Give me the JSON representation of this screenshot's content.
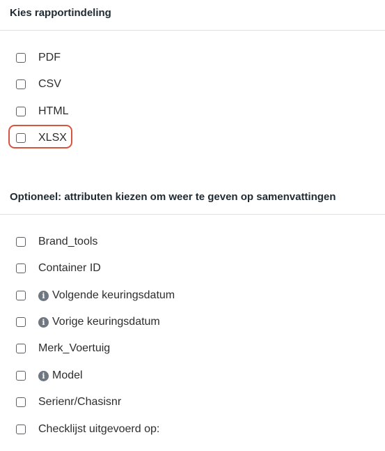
{
  "format_section": {
    "title": "Kies rapportindeling",
    "options": [
      {
        "label": "PDF",
        "checked": false
      },
      {
        "label": "CSV",
        "checked": false
      },
      {
        "label": "HTML",
        "checked": false
      },
      {
        "label": "XLSX",
        "checked": false,
        "highlighted": true
      }
    ]
  },
  "attributes_section": {
    "title": "Optioneel: attributen kiezen om weer te geven op samenvattingen",
    "options": [
      {
        "label": "Brand_tools",
        "checked": false,
        "info_icon": false
      },
      {
        "label": "Container ID",
        "checked": false,
        "info_icon": false
      },
      {
        "label": "Volgende keuringsdatum",
        "checked": false,
        "info_icon": true
      },
      {
        "label": "Vorige keuringsdatum",
        "checked": false,
        "info_icon": true
      },
      {
        "label": "Merk_Voertuig",
        "checked": false,
        "info_icon": false
      },
      {
        "label": "Model",
        "checked": false,
        "info_icon": true
      },
      {
        "label": "Serienr/Chasisnr",
        "checked": false,
        "info_icon": false
      },
      {
        "label": "Checklijst uitgevoerd op:",
        "checked": false,
        "info_icon": false
      }
    ]
  },
  "icons": {
    "info": "info-icon"
  },
  "colors": {
    "highlight": "#d9533f",
    "info_icon": "#6f7780"
  }
}
